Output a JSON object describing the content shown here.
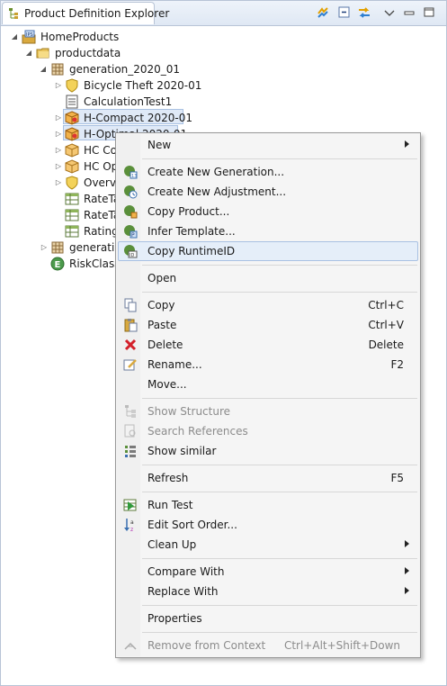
{
  "view": {
    "title": "Product Definition Explorer",
    "toolbar_icons": [
      "sync-icon",
      "collapse-all-icon",
      "link-with-editor-icon",
      "view-menu-icon",
      "minimize-icon",
      "maximize-icon"
    ]
  },
  "tree": [
    {
      "label": "HomeProducts",
      "icon": "project-icon"
    },
    {
      "label": "productdata",
      "icon": "folder-icon"
    },
    {
      "label": "generation_2020_01",
      "icon": "package-grid-icon"
    },
    {
      "label": "Bicycle Theft 2020-01",
      "icon": "shield-icon"
    },
    {
      "label": "CalculationTest1",
      "icon": "calc-icon"
    },
    {
      "label": "H-Compact 2020-01",
      "icon": "product-box-icon"
    },
    {
      "label": "H-Optimal 2020-01",
      "icon": "product-box-icon"
    },
    {
      "label": "HC Co",
      "icon": "box-icon"
    },
    {
      "label": "HC Op",
      "icon": "box-icon"
    },
    {
      "label": "Overvo",
      "icon": "shield-icon"
    },
    {
      "label": "RateTa",
      "icon": "table-icon"
    },
    {
      "label": "RateTa",
      "icon": "table-icon"
    },
    {
      "label": "Rating",
      "icon": "table-icon"
    },
    {
      "label": "generation",
      "icon": "package-grid-icon"
    },
    {
      "label": "RiskClass",
      "icon": "enum-icon"
    }
  ],
  "menu": {
    "items": [
      {
        "label": "New",
        "accel": "",
        "submenu": true
      },
      {
        "label": "Create New Generation...",
        "accel": "",
        "icon": "new-generation-icon"
      },
      {
        "label": "Create New Adjustment...",
        "accel": "",
        "icon": "new-adjustment-icon"
      },
      {
        "label": "Copy Product...",
        "accel": "",
        "icon": "copy-product-icon"
      },
      {
        "label": "Infer Template...",
        "accel": "",
        "icon": "infer-template-icon"
      },
      {
        "label": "Copy RuntimeID",
        "accel": "",
        "icon": "runtime-id-icon"
      },
      {
        "label": "Open",
        "accel": ""
      },
      {
        "label": "Copy",
        "accel": "Ctrl+C",
        "icon": "copy-icon"
      },
      {
        "label": "Paste",
        "accel": "Ctrl+V",
        "icon": "paste-icon"
      },
      {
        "label": "Delete",
        "accel": "Delete",
        "icon": "delete-icon"
      },
      {
        "label": "Rename...",
        "accel": "F2",
        "icon": "rename-icon"
      },
      {
        "label": "Move...",
        "accel": ""
      },
      {
        "label": "Show Structure",
        "accel": "",
        "icon": "show-structure-icon"
      },
      {
        "label": "Search References",
        "accel": "",
        "icon": "search-references-icon"
      },
      {
        "label": "Show similar",
        "accel": "",
        "icon": "show-similar-icon"
      },
      {
        "label": "Refresh",
        "accel": "F5"
      },
      {
        "label": "Run Test",
        "accel": "",
        "icon": "run-test-icon"
      },
      {
        "label": "Edit Sort Order...",
        "accel": "",
        "icon": "sort-order-icon"
      },
      {
        "label": "Clean Up",
        "accel": "",
        "submenu": true
      },
      {
        "label": "Compare With",
        "accel": "",
        "submenu": true
      },
      {
        "label": "Replace With",
        "accel": "",
        "submenu": true
      },
      {
        "label": "Properties",
        "accel": ""
      },
      {
        "label": "Remove from Context",
        "accel": "Ctrl+Alt+Shift+Down",
        "icon": "remove-context-icon"
      }
    ]
  },
  "colors": {
    "accent": "#a9c1e2",
    "selection": "#dfe9f7",
    "menu_bg": "#f5f5f5"
  }
}
